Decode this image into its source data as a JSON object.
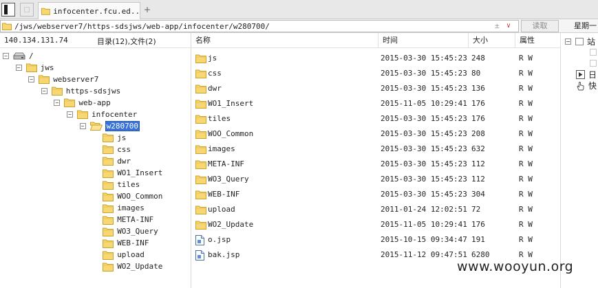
{
  "window": {
    "tab_title": "infocenter.fcu.ed...",
    "tab_add": "+"
  },
  "address_bar": {
    "path": "/jws/webserver7/https-sdsjws/web-app/infocenter/w280700/",
    "read_button": "读取",
    "right_header": "星期一"
  },
  "left_pane": {
    "ip": "140.134.131.74",
    "counts": "目录(12),文件(2)",
    "tree": [
      {
        "label": "/",
        "icon": "drive",
        "expanded": true
      },
      {
        "label": "jws",
        "icon": "folder",
        "expanded": true
      },
      {
        "label": "webserver7",
        "icon": "folder",
        "expanded": true
      },
      {
        "label": "https-sdsjws",
        "icon": "folder",
        "expanded": true
      },
      {
        "label": "web-app",
        "icon": "folder",
        "expanded": true
      },
      {
        "label": "infocenter",
        "icon": "folder",
        "expanded": true
      },
      {
        "label": "w280700",
        "icon": "folder-open",
        "expanded": true,
        "selected": true
      },
      {
        "label": "js",
        "icon": "folder"
      },
      {
        "label": "css",
        "icon": "folder"
      },
      {
        "label": "dwr",
        "icon": "folder"
      },
      {
        "label": "WO1_Insert",
        "icon": "folder"
      },
      {
        "label": "tiles",
        "icon": "folder"
      },
      {
        "label": "WOO_Common",
        "icon": "folder"
      },
      {
        "label": "images",
        "icon": "folder"
      },
      {
        "label": "META-INF",
        "icon": "folder"
      },
      {
        "label": "WO3_Query",
        "icon": "folder"
      },
      {
        "label": "WEB-INF",
        "icon": "folder"
      },
      {
        "label": "upload",
        "icon": "folder"
      },
      {
        "label": "WO2_Update",
        "icon": "folder"
      }
    ]
  },
  "file_list": {
    "columns": {
      "name": "名称",
      "time": "时间",
      "size": "大小",
      "attr": "属性"
    },
    "rows": [
      {
        "icon": "folder",
        "name": "js",
        "time": "2015-03-30 15:45:23",
        "size": "248",
        "attr": "R W"
      },
      {
        "icon": "folder",
        "name": "css",
        "time": "2015-03-30 15:45:23",
        "size": "80",
        "attr": "R W"
      },
      {
        "icon": "folder",
        "name": "dwr",
        "time": "2015-03-30 15:45:23",
        "size": "136",
        "attr": "R W"
      },
      {
        "icon": "folder",
        "name": "WO1_Insert",
        "time": "2015-11-05 10:29:41",
        "size": "176",
        "attr": "R W"
      },
      {
        "icon": "folder",
        "name": "tiles",
        "time": "2015-03-30 15:45:23",
        "size": "176",
        "attr": "R W"
      },
      {
        "icon": "folder",
        "name": "WOO_Common",
        "time": "2015-03-30 15:45:23",
        "size": "208",
        "attr": "R W"
      },
      {
        "icon": "folder",
        "name": "images",
        "time": "2015-03-30 15:45:23",
        "size": "632",
        "attr": "R W"
      },
      {
        "icon": "folder",
        "name": "META-INF",
        "time": "2015-03-30 15:45:23",
        "size": "112",
        "attr": "R W"
      },
      {
        "icon": "folder",
        "name": "WO3_Query",
        "time": "2015-03-30 15:45:23",
        "size": "112",
        "attr": "R W"
      },
      {
        "icon": "folder",
        "name": "WEB-INF",
        "time": "2015-03-30 15:45:23",
        "size": "304",
        "attr": "R W"
      },
      {
        "icon": "folder",
        "name": "upload",
        "time": "2011-01-24 12:02:51",
        "size": "72",
        "attr": "R W"
      },
      {
        "icon": "folder",
        "name": "WO2_Update",
        "time": "2015-11-05 10:29:41",
        "size": "176",
        "attr": "R W"
      },
      {
        "icon": "file",
        "name": "o.jsp",
        "time": "2015-10-15 09:34:47",
        "size": "191",
        "attr": "R W"
      },
      {
        "icon": "file",
        "name": "bak.jsp",
        "time": "2015-11-12 09:47:51",
        "size": "6280",
        "attr": "R W"
      }
    ]
  },
  "right_pane": {
    "item1": "站",
    "item2": "日",
    "item3": "快"
  },
  "watermark": "www.wooyun.org",
  "colors": {
    "folder_fill": "#f7d774",
    "folder_border": "#c9a227",
    "selection": "#3874d8"
  }
}
